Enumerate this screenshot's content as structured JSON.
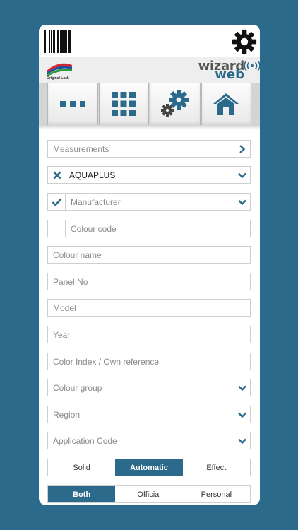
{
  "colors": {
    "accent": "#2c6a8c",
    "background": "#2c6a8c",
    "panel": "#ffffff"
  },
  "header": {
    "barcode_icon": "barcode-icon",
    "settings_icon": "gear-icon",
    "brand_left": "Original Lack",
    "brand_wizard": "wizard",
    "brand_web": "web"
  },
  "tabs": [
    {
      "name": "more",
      "icon": "dots-icon"
    },
    {
      "name": "grid",
      "icon": "grid-icon"
    },
    {
      "name": "settings",
      "icon": "gears-icon"
    },
    {
      "name": "home",
      "icon": "home-icon"
    }
  ],
  "form": {
    "measurements": "Measurements",
    "brand_value": "AQUAPLUS",
    "manufacturer": "Manufacturer",
    "colour_code": "Colour code",
    "colour_name": "Colour name",
    "panel_no": "Panel No",
    "model": "Model",
    "year": "Year",
    "color_index": "Color Index / Own reference",
    "colour_group": "Colour group",
    "region": "Region",
    "application_code": "Application Code"
  },
  "finish": {
    "options": [
      "Solid",
      "Automatic",
      "Effect"
    ],
    "selected": "Automatic"
  },
  "source": {
    "options": [
      "Both",
      "Official",
      "Personal"
    ],
    "selected": "Both"
  }
}
